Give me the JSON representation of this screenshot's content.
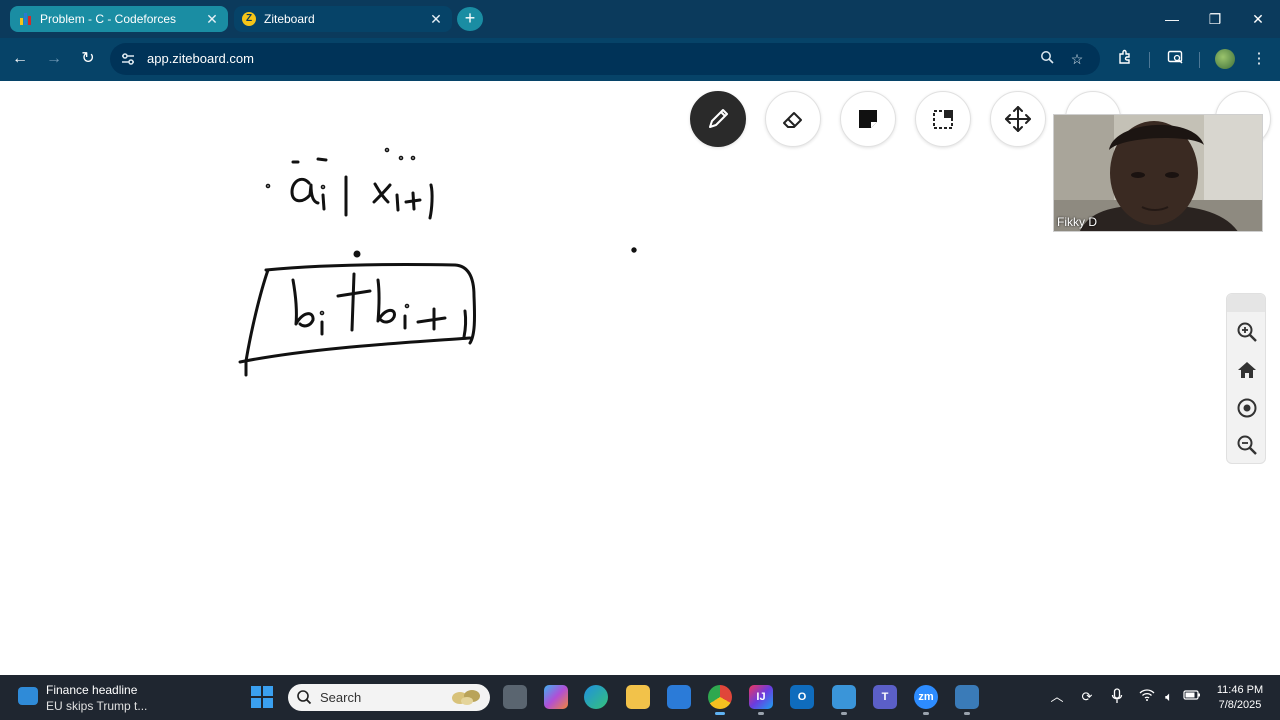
{
  "browser": {
    "tabs": [
      {
        "title": "Problem - C - Codeforces",
        "active": false
      },
      {
        "title": "Ziteboard",
        "active": true
      }
    ],
    "address": {
      "url": "app.ziteboard.com"
    },
    "colors": {
      "tabstrip": "#0b3a5c",
      "toolbar": "#064368",
      "inactive_tab": "#1a8da3"
    }
  },
  "board": {
    "tools": [
      {
        "name": "pen",
        "icon": "pencil-icon",
        "active": true
      },
      {
        "name": "eraser",
        "icon": "eraser-icon",
        "active": false
      },
      {
        "name": "sticky-note",
        "icon": "sticky-note-icon",
        "active": false
      },
      {
        "name": "select",
        "icon": "select-icon",
        "active": false
      },
      {
        "name": "move",
        "icon": "move-icon",
        "active": false
      }
    ],
    "video": {
      "participant_name": "Fikky D"
    },
    "zoom_controls": [
      "zoom-in-icon",
      "home-icon",
      "target-icon",
      "zoom-out-icon"
    ]
  },
  "taskbar": {
    "news": {
      "title": "Finance headline",
      "subtitle": "EU skips Trump t..."
    },
    "search": {
      "placeholder": "Search"
    },
    "apps": [
      "file-explorer-window",
      "copilot",
      "edge",
      "file-explorer",
      "store",
      "chrome",
      "intellij",
      "outlook",
      "camera",
      "teams",
      "zoom",
      "task-manager"
    ],
    "clock": {
      "time": "11:46 PM",
      "date": "7/8/2025"
    }
  }
}
